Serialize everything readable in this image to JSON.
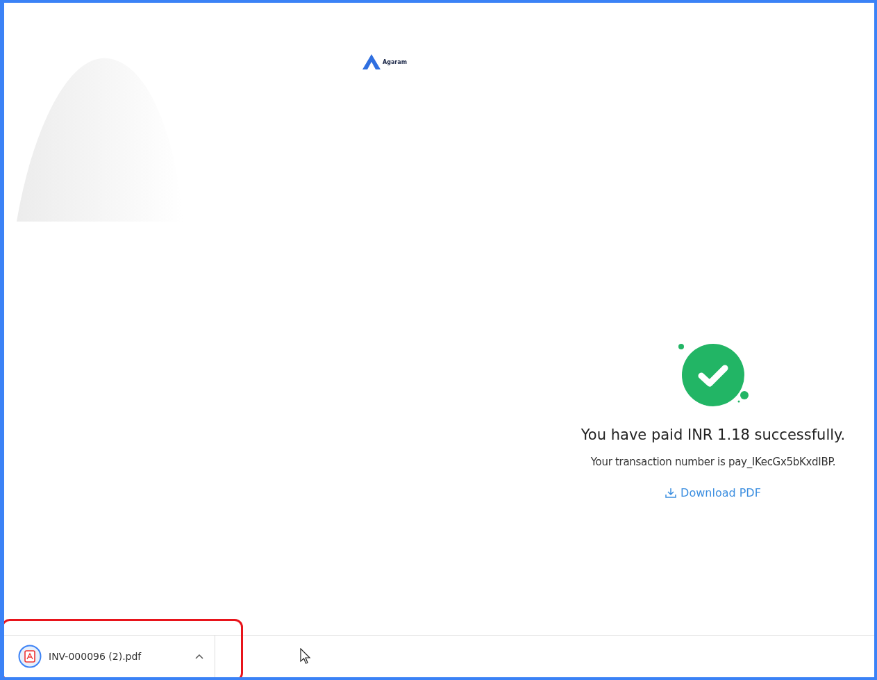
{
  "logo": {
    "text": "Agaram"
  },
  "payment": {
    "succeeded": true,
    "message": "You have paid INR 1.18 successfully.",
    "transaction": "Your transaction number is pay_IKecGx5bKxdIBP.",
    "download_link": "Download PDF"
  },
  "download_bar": {
    "items": [
      {
        "filename": "INV-000096 (2).pdf",
        "highlighted": true
      }
    ]
  }
}
